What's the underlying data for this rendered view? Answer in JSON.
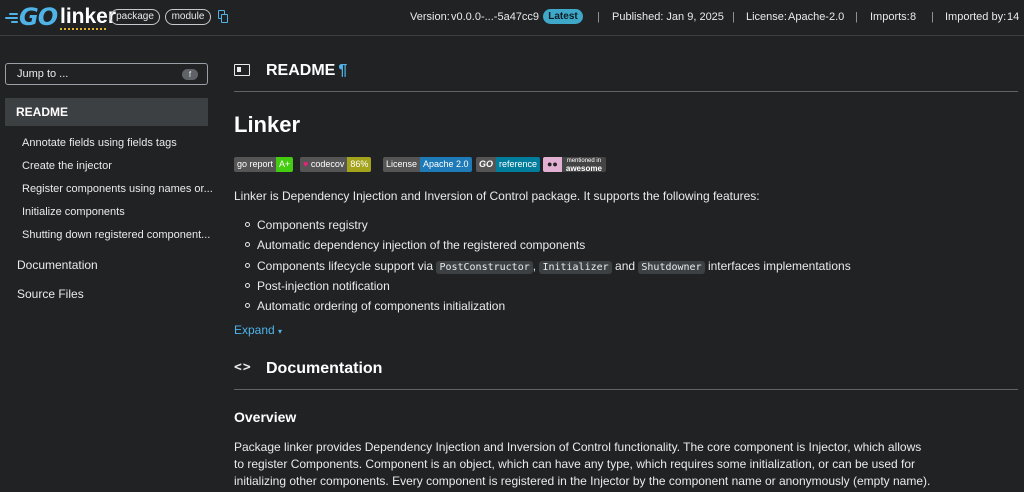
{
  "header": {
    "logo_text": "GO",
    "package_name": "linker",
    "chips": [
      "package",
      "module"
    ],
    "version_label": "Version:",
    "version_value": "v0.0.0-...-5a47cc9",
    "latest_badge": "Latest",
    "published": "Published: Jan 9, 2025",
    "license_label": "License:",
    "license_value": "Apache-2.0",
    "imports_label": "Imports:",
    "imports_value": "8",
    "imported_by_label": "Imported by:",
    "imported_by_value": "14",
    "separator": "|"
  },
  "sidebar": {
    "jump_placeholder": "Jump to ...",
    "jump_key": "f",
    "active_item": "README",
    "sub_items": [
      "Annotate fields using fields tags",
      "Create the injector",
      "Register components using names or...",
      "Initialize components",
      "Shutting down registered component..."
    ],
    "top_items": [
      "Documentation",
      "Source Files"
    ]
  },
  "readme": {
    "section_title": "README",
    "pilcrow": "¶",
    "title": "Linker",
    "badges": {
      "goreport": {
        "left": "go report",
        "right": "A+"
      },
      "codecov": {
        "left": "codecov",
        "right": "86%"
      },
      "license": {
        "left": "License",
        "right": "Apache 2.0"
      },
      "reference": {
        "left": "GO",
        "right": "reference"
      },
      "awesome": {
        "top": "mentioned in",
        "bottom": "awesome"
      }
    },
    "intro": "Linker is Dependency Injection and Inversion of Control package. It supports the following features:",
    "features": {
      "f1": "Components registry",
      "f2": "Automatic dependency injection of the registered components",
      "f3_pre": "Components lifecycle support via",
      "f3_code1": "PostConstructor",
      "f3_comma": ",",
      "f3_code2": "Initializer",
      "f3_and": "and",
      "f3_code3": "Shutdowner",
      "f3_post": "interfaces implementations",
      "f4": "Post-injection notification",
      "f5": "Automatic ordering of components initialization"
    },
    "expand_label": "Expand",
    "expand_caret": "▾"
  },
  "documentation": {
    "section_title": "Documentation",
    "code_glyph": "<>",
    "overview_title": "Overview",
    "overview_text": "Package linker provides Dependency Injection and Inversion of Control functionality. The core component is Injector, which allows to register Components. Component is an object, which can have any type, which requires some initialization, or can be used for initializing other components. Every component is registered in the Injector by the component name or anonymously (empty name)."
  },
  "colors": {
    "background": "#202224",
    "link": "#4fb3e8",
    "latest_badge": "#3fa7c7",
    "sidebar_active": "#3c4043"
  }
}
